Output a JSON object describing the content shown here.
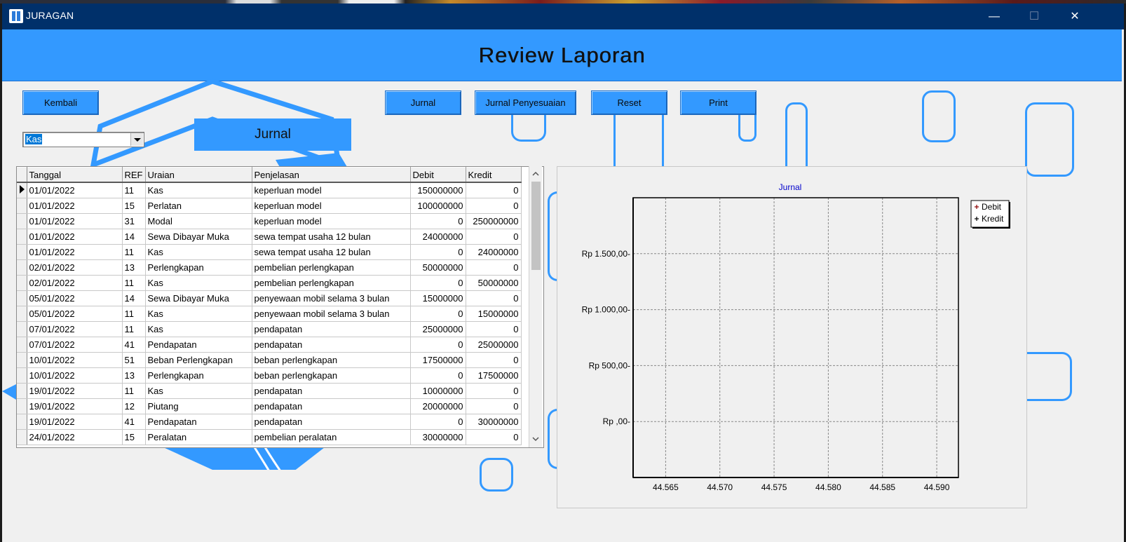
{
  "window": {
    "title": "JURAGAN",
    "minimize_glyph": "—",
    "maximize_glyph": "☐",
    "close_glyph": "✕"
  },
  "header": {
    "title": "Review Laporan"
  },
  "toolbar": {
    "kembali": "Kembali",
    "jurnal": "Jurnal",
    "jurnal_penyesuaian": "Jurnal Penyesuaian",
    "reset": "Reset",
    "print": "Print"
  },
  "filter": {
    "selected": "Kas"
  },
  "section_label": "Jurnal",
  "table": {
    "columns": [
      "Tanggal",
      "REF",
      "Uraian",
      "Penjelasan",
      "Debit",
      "Kredit"
    ],
    "rows": [
      [
        "01/01/2022",
        "11",
        "Kas",
        "keperluan model",
        "150000000",
        "0"
      ],
      [
        "01/01/2022",
        "15",
        "Perlatan",
        "keperluan model",
        "100000000",
        "0"
      ],
      [
        "01/01/2022",
        "31",
        "Modal",
        "keperluan model",
        "0",
        "250000000"
      ],
      [
        "01/01/2022",
        "14",
        "Sewa Dibayar Muka",
        "sewa tempat usaha 12 bulan",
        "24000000",
        "0"
      ],
      [
        "01/01/2022",
        "11",
        "Kas",
        "sewa tempat usaha 12 bulan",
        "0",
        "24000000"
      ],
      [
        "02/01/2022",
        "13",
        "Perlengkapan",
        "pembelian perlengkapan",
        "50000000",
        "0"
      ],
      [
        "02/01/2022",
        "11",
        "Kas",
        "pembelian perlengkapan",
        "0",
        "50000000"
      ],
      [
        "05/01/2022",
        "14",
        "Sewa Dibayar Muka",
        "penyewaan mobil selama 3 bulan",
        "15000000",
        "0"
      ],
      [
        "05/01/2022",
        "11",
        "Kas",
        "penyewaan mobil selama 3 bulan",
        "0",
        "15000000"
      ],
      [
        "07/01/2022",
        "11",
        "Kas",
        "pendapatan",
        "25000000",
        "0"
      ],
      [
        "07/01/2022",
        "41",
        "Pendapatan",
        "pendapatan",
        "0",
        "25000000"
      ],
      [
        "10/01/2022",
        "51",
        "Beban Perlengkapan",
        "beban perlengkapan",
        "17500000",
        "0"
      ],
      [
        "10/01/2022",
        "13",
        "Perlengkapan",
        "beban perlengkapan",
        "0",
        "17500000"
      ],
      [
        "19/01/2022",
        "11",
        "Kas",
        "pendapatan",
        "10000000",
        "0"
      ],
      [
        "19/01/2022",
        "12",
        "Piutang",
        "pendapatan",
        "20000000",
        "0"
      ],
      [
        "19/01/2022",
        "41",
        "Pendapatan",
        "pendapatan",
        "0",
        "30000000"
      ],
      [
        "24/01/2022",
        "15",
        "Peralatan",
        "pembelian peralatan",
        "30000000",
        "0"
      ]
    ]
  },
  "chart_data": {
    "type": "line",
    "title": "Jurnal",
    "y_tick_labels": [
      "Rp 1.500,00-",
      "Rp 1.000,00-",
      "Rp 500,00-",
      "Rp ,00-"
    ],
    "y_ticks": [
      1500,
      1000,
      500,
      0
    ],
    "x_tick_labels": [
      "44.565",
      "44.570",
      "44.575",
      "44.580",
      "44.585",
      "44.590"
    ],
    "x_ticks": [
      44565,
      44570,
      44575,
      44580,
      44585,
      44590
    ],
    "xlim": [
      44562,
      44592
    ],
    "ylim": [
      -500,
      2000
    ],
    "grid": true,
    "legend_position": "top-right",
    "series": [
      {
        "name": "Debit",
        "color": "#8b0000",
        "values": []
      },
      {
        "name": "Kredit",
        "color": "#000000",
        "values": []
      }
    ]
  },
  "colors": {
    "titlebar": "#00306a",
    "accent": "#3399ff",
    "chart_title": "#0000cc"
  }
}
